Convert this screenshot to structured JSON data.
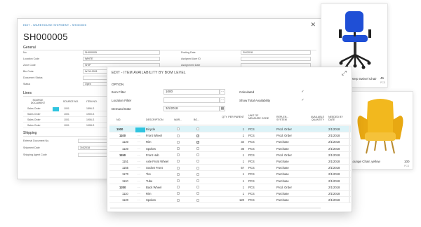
{
  "shipment": {
    "breadcrumb": "EDIT - WAREHOUSE SHIPMENT - SH000005",
    "title": "SH000005",
    "general_label": "General",
    "fields_left": [
      {
        "label": "No.",
        "value": "SH000005"
      },
      {
        "label": "Location Code",
        "value": "WHITE"
      },
      {
        "label": "Zone Code",
        "value": "SHIP"
      },
      {
        "label": "Bin Code",
        "value": "W-09-0001"
      },
      {
        "label": "Document Status",
        "value": ""
      },
      {
        "label": "Status",
        "value": "Open"
      }
    ],
    "fields_right": [
      {
        "label": "Posting Date",
        "value": "3/4/2018"
      },
      {
        "label": "Assigned User ID",
        "value": ""
      },
      {
        "label": "Assignment Date",
        "value": ""
      }
    ],
    "lines_label": "Lines",
    "lines_headers": [
      "SOURCE DOCUMENT",
      "SOURCE NO.",
      "ITEM NO."
    ],
    "lines_rows": [
      {
        "doc": "Sales Order",
        "no": "1001",
        "item": "1896-S"
      },
      {
        "doc": "Sales Order",
        "no": "1001",
        "item": "1900-S"
      },
      {
        "doc": "Sales Order",
        "no": "1001",
        "item": "1906-S"
      },
      {
        "doc": "Sales Order",
        "no": "1001",
        "item": "1908-S"
      }
    ],
    "shipping_label": "Shipping",
    "shipping_fields": [
      {
        "label": "External Document No.",
        "value": ""
      },
      {
        "label": "Shipment Date",
        "value": "3/4/2018"
      },
      {
        "label": "Shipping Agent Code",
        "value": ""
      }
    ]
  },
  "cards": [
    {
      "name": "Antwerp Swivel Chair",
      "price": "45",
      "unit": "PCS"
    },
    {
      "name": "Lounge Chair, yellow",
      "price": "100",
      "unit": "PCS"
    }
  ],
  "dialog": {
    "title": "EDIT - ITEM AVAILABILITY BY BOM LEVEL",
    "option_label": "OPTION",
    "item_filter_label": "Item Filter",
    "item_filter_value": "1000",
    "location_filter_label": "Location Filter",
    "location_filter_value": "",
    "demand_date_label": "Demand Date",
    "demand_date_value": "3/1/2018",
    "calculated_label": "Calculated",
    "calculated_checked": true,
    "show_total_label": "Show Total Availability",
    "show_total_checked": true,
    "columns": [
      "NO.",
      "DESCRIPTION",
      "WAR...",
      "BO...",
      "QTY. PER PARENT",
      "UNIT OF MEASURE CODE",
      "REPLEN... SYSTEM",
      "AVAILABLE QUANTITY",
      "NEEDED BY DATE"
    ],
    "rows": [
      {
        "no": "1000",
        "desc": "Bicycle",
        "war": false,
        "bo": false,
        "qty": "1",
        "uom": "PCS",
        "rep": "Prod. Order",
        "avail": "",
        "date": "2/1/2018",
        "selected": true,
        "indent": 0
      },
      {
        "no": "1100",
        "desc": "Front Wheel",
        "war": false,
        "bo": true,
        "qty": "1",
        "uom": "PCS",
        "rep": "Prod. Order",
        "avail": "",
        "date": "2/1/2018",
        "selected": false,
        "indent": 1
      },
      {
        "no": "1120",
        "desc": "Rim",
        "war": false,
        "bo": true,
        "qty": "34",
        "uom": "PCS",
        "rep": "Purchase",
        "avail": "",
        "date": "2/1/2018",
        "selected": false,
        "indent": 2
      },
      {
        "no": "1120",
        "desc": "Spokes",
        "war": false,
        "bo": false,
        "qty": "36",
        "uom": "PCS",
        "rep": "Purchase",
        "avail": "",
        "date": "2/1/2018",
        "selected": false,
        "indent": 2
      },
      {
        "no": "1150",
        "desc": "Front Hub",
        "war": false,
        "bo": false,
        "qty": "1",
        "uom": "PCS",
        "rep": "Prod. Order",
        "avail": "",
        "date": "2/1/2018",
        "selected": false,
        "indent": 1
      },
      {
        "no": "1151",
        "desc": "Axle Front Wheel",
        "war": false,
        "bo": false,
        "qty": "1",
        "uom": "PCS",
        "rep": "Purchase",
        "avail": "",
        "date": "2/1/2018",
        "selected": false,
        "indent": 2
      },
      {
        "no": "1155",
        "desc": "Socket Front",
        "war": false,
        "bo": false,
        "qty": "57",
        "uom": "PCS",
        "rep": "Purchase",
        "avail": "",
        "date": "2/1/2018",
        "selected": false,
        "indent": 2
      },
      {
        "no": "1170",
        "desc": "Tire",
        "war": false,
        "bo": false,
        "qty": "1",
        "uom": "PCS",
        "rep": "Purchase",
        "avail": "",
        "date": "2/1/2018",
        "selected": false,
        "indent": 2
      },
      {
        "no": "1110",
        "desc": "Tube",
        "war": false,
        "bo": false,
        "qty": "1",
        "uom": "PCS",
        "rep": "Purchase",
        "avail": "",
        "date": "2/1/2018",
        "selected": false,
        "indent": 2
      },
      {
        "no": "1200",
        "desc": "Back Wheel",
        "war": false,
        "bo": false,
        "qty": "1",
        "uom": "PCS",
        "rep": "Prod. Order",
        "avail": "",
        "date": "2/1/2018",
        "selected": false,
        "indent": 1
      },
      {
        "no": "1110",
        "desc": "Rim",
        "war": false,
        "bo": false,
        "qty": "1",
        "uom": "PCS",
        "rep": "Purchase",
        "avail": "",
        "date": "2/1/2018",
        "selected": false,
        "indent": 2
      },
      {
        "no": "1120",
        "desc": "Spokes",
        "war": false,
        "bo": false,
        "qty": "120",
        "uom": "PCS",
        "rep": "Purchase",
        "avail": "",
        "date": "2/1/2018",
        "selected": false,
        "indent": 2
      }
    ]
  },
  "colors": {
    "accent": "#2fc4df",
    "chair_blue": "#1f4fd6",
    "chair_yellow": "#f2b81e"
  }
}
